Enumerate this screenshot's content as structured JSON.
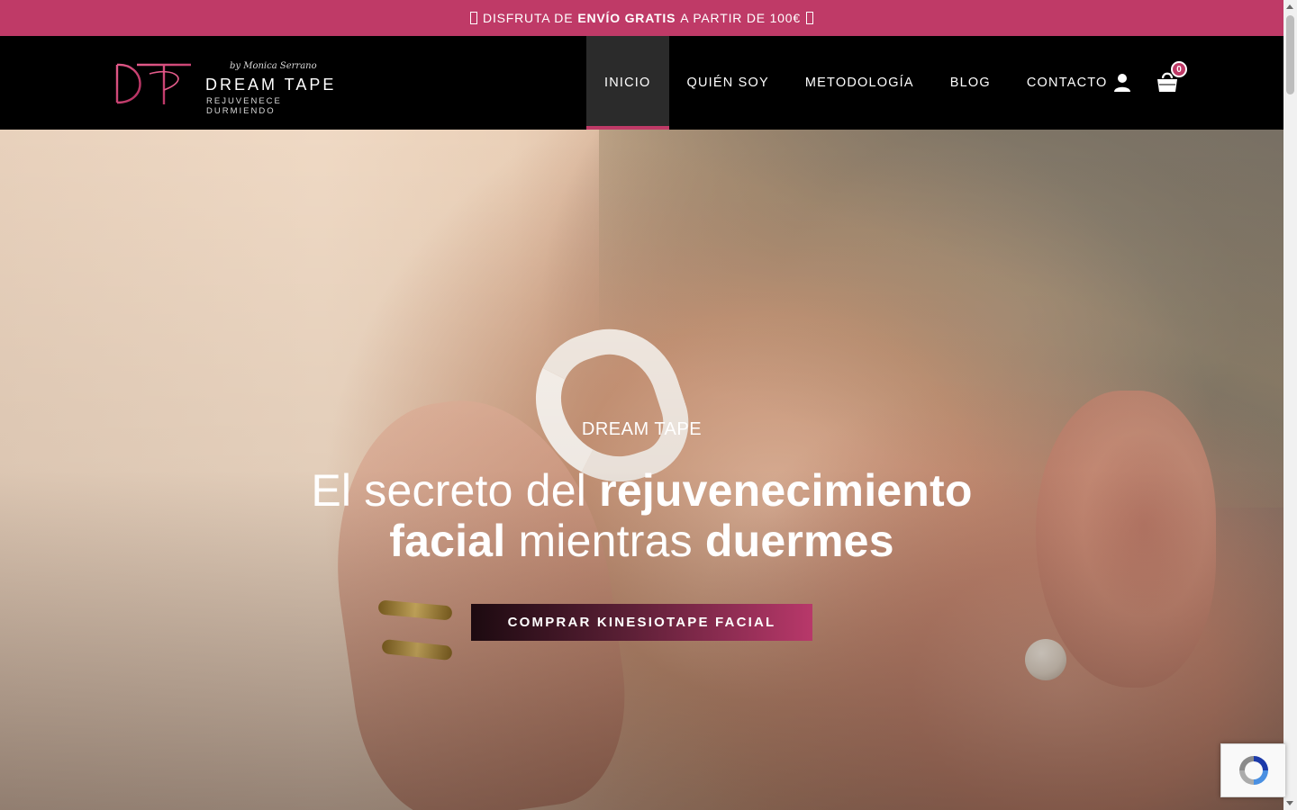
{
  "promo": {
    "prefix": "DISFRUTA DE",
    "highlight": "ENVÍO GRATIS",
    "suffix": "A PARTIR DE 100€"
  },
  "logo": {
    "monogram": "DT",
    "by": "by Monica Serrano",
    "brand": "DREAM TAPE",
    "tagline": "REJUVENECE DURMIENDO"
  },
  "nav": {
    "items": [
      {
        "label": "INICIO",
        "active": true
      },
      {
        "label": "QUIÉN SOY",
        "active": false
      },
      {
        "label": "METODOLOGÍA",
        "active": false
      },
      {
        "label": "BLOG",
        "active": false
      },
      {
        "label": "CONTACTO",
        "active": false
      }
    ],
    "user_icon": "user-icon",
    "cart_icon": "shopping-bag-icon",
    "cart_count": "0"
  },
  "hero": {
    "kicker": "DREAM TAPE",
    "title_part1": "El secreto del ",
    "title_bold1": "rejuvenecimiento",
    "title_bold2": "facial",
    "title_part2": " mientras ",
    "title_bold3": "duermes",
    "cta_label": "COMPRAR KINESIOTAPE FACIAL"
  },
  "colors": {
    "accent": "#bf3a67",
    "header_bg": "#000000",
    "active_nav_bg": "#2b2b2b"
  }
}
